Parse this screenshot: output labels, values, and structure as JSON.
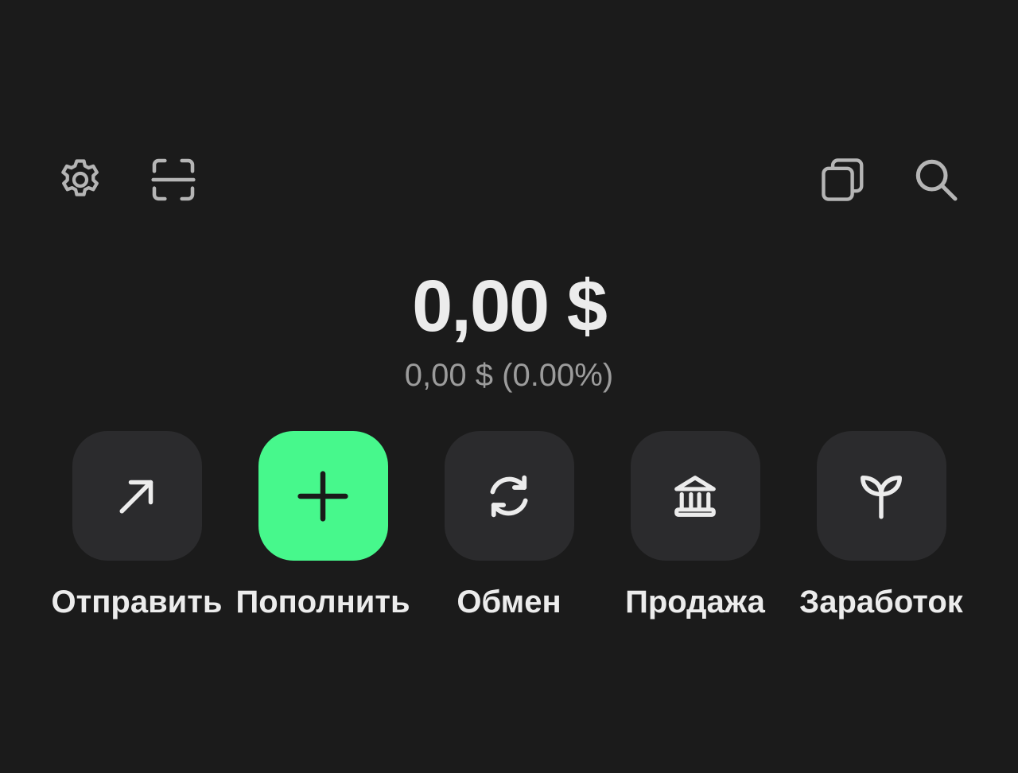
{
  "toolbar": {
    "settings_icon": "gear-icon",
    "scan_icon": "scan-icon",
    "wallets_icon": "copy-stack-icon",
    "search_icon": "search-icon"
  },
  "balance": {
    "total": "0,00 $",
    "change": "0,00 $ (0.00%)"
  },
  "actions": [
    {
      "label": "Отправить",
      "icon": "arrow-up-right-icon"
    },
    {
      "label": "Пополнить",
      "icon": "plus-icon"
    },
    {
      "label": "Обмен",
      "icon": "refresh-icon"
    },
    {
      "label": "Продажа",
      "icon": "bank-icon"
    },
    {
      "label": "Заработок",
      "icon": "sprout-icon"
    }
  ],
  "colors": {
    "background": "#1b1b1b",
    "tile": "#2b2b2d",
    "accent": "#47f88c",
    "text_primary": "#ececec",
    "text_secondary": "#9c9c9c"
  }
}
